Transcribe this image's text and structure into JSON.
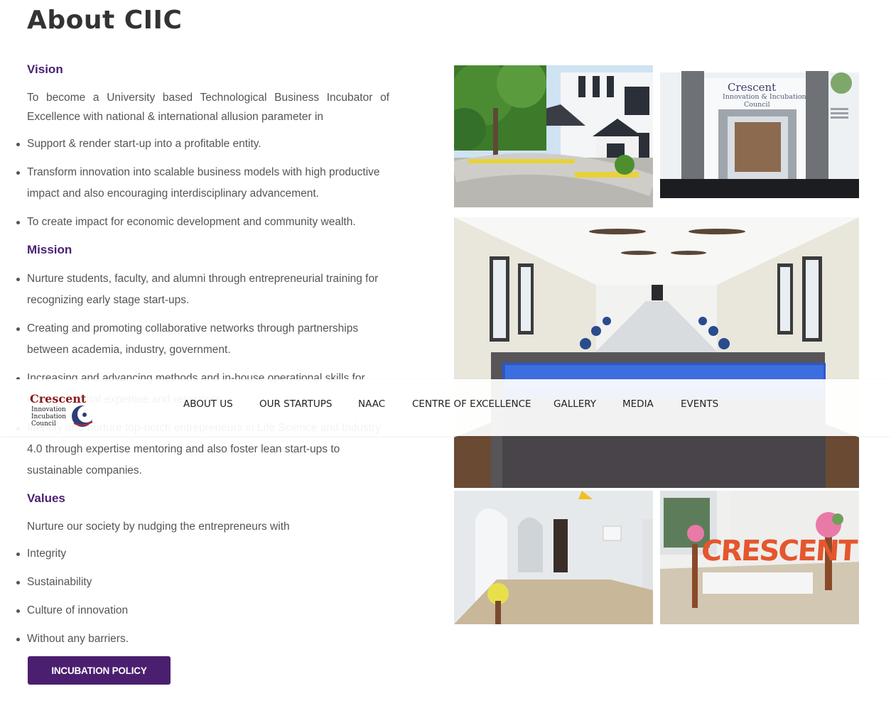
{
  "page_title": "About CIIC",
  "vision": {
    "heading": "Vision",
    "intro": "To become a University based Technological Business Incubator of Excellence with national & international allusion parameter in",
    "bullets": [
      "Support & render start-up into a profitable entity.",
      "Transform innovation into scalable business models with high productive impact and also encouraging interdisciplinary advancement.",
      "To create impact for economic development and community wealth."
    ]
  },
  "mission": {
    "heading": "Mission",
    "bullets": [
      "Nurture students, faculty, and alumni through entrepreneurial training for recognizing early stage start-ups.",
      "Creating and promoting collaborative networks through partnerships between academia, industry, government.",
      "Increasing and advancing methods and in-house operational skills for entrepreneurial expertise and resources.",
      "Identify and nurture top-notch entrepreneurs in Life Science and Industry 4.0 through expertise mentoring and also foster lean start-ups to sustainable companies."
    ]
  },
  "values": {
    "heading": "Values",
    "intro": "Nurture our society by nudging the entrepreneurs with",
    "bullets": [
      "Integrity",
      "Sustainability",
      "Culture of innovation",
      "Without any barriers."
    ]
  },
  "button": {
    "label": "INCUBATION POLICY"
  },
  "gallery": {
    "entrance_sign": {
      "brand": "Crescent",
      "line1": "Innovation & Incubation",
      "line2": "Council"
    },
    "hall_sign": "CRESCENT"
  },
  "nav": {
    "logo": {
      "brand": "Crescent",
      "line1": "Innovation",
      "line2": "Incubation",
      "line3": "Council"
    },
    "items": [
      "ABOUT US",
      "OUR STARTUPS",
      "NAAC",
      "CENTRE OF EXCELLENCE",
      "GALLERY",
      "MEDIA",
      "EVENTS"
    ]
  },
  "colors": {
    "accent": "#4b1f6f",
    "heading": "#4b2173",
    "text": "#555555"
  }
}
